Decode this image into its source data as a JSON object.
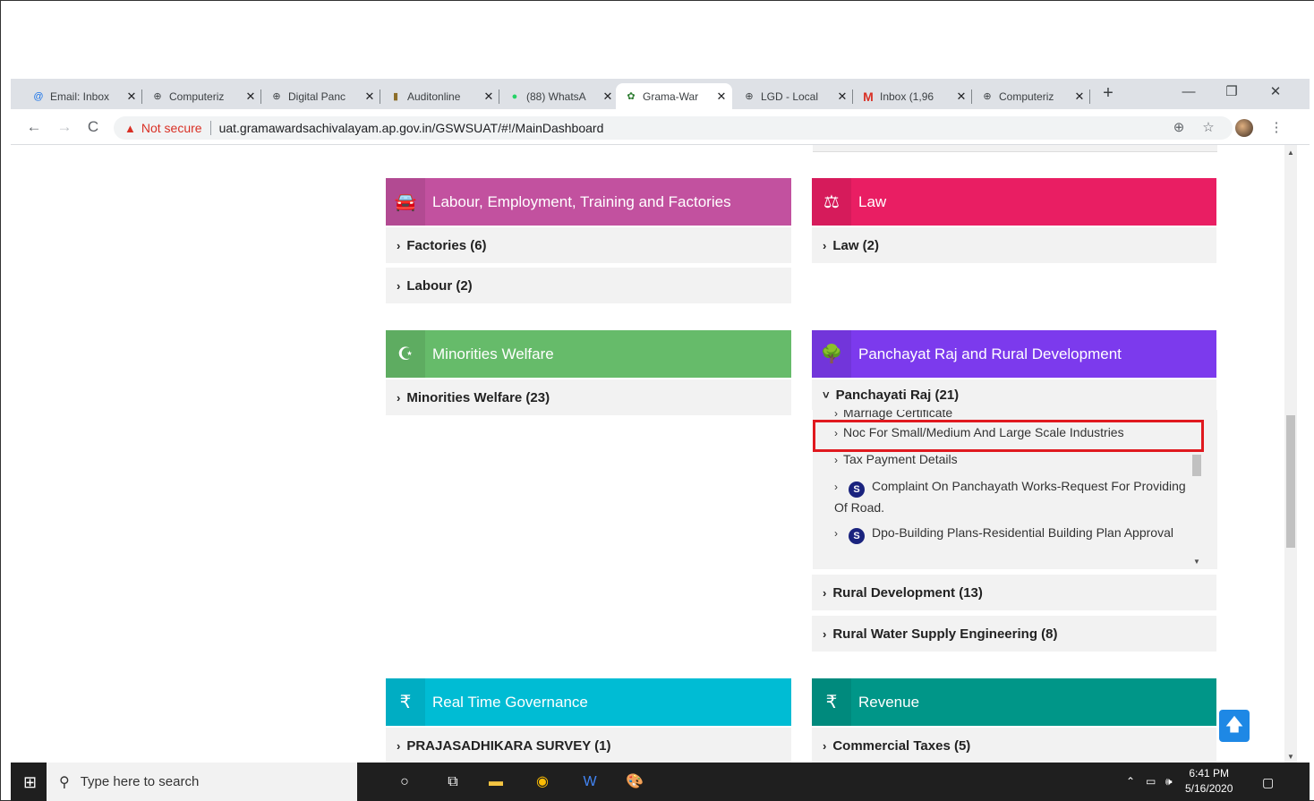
{
  "browser": {
    "tabs": [
      {
        "label": "Email: Inbox",
        "icon": "@",
        "active": false
      },
      {
        "label": "Computeriz",
        "icon": "⊕",
        "active": false
      },
      {
        "label": "Digital Panc",
        "icon": "⊕",
        "active": false
      },
      {
        "label": "Auditonline",
        "icon": "▮",
        "active": false
      },
      {
        "label": "(88) WhatsA",
        "icon": "●",
        "active": false
      },
      {
        "label": "Grama-War",
        "icon": "✿",
        "active": true
      },
      {
        "label": "LGD - Local",
        "icon": "⊕",
        "active": false
      },
      {
        "label": "Inbox (1,96",
        "icon": "M",
        "active": false
      },
      {
        "label": "Computeriz",
        "icon": "⊕",
        "active": false
      }
    ],
    "new_tab": "+",
    "not_secure": "Not secure",
    "url": "uat.gramawardsachivalayam.ap.gov.in/GSWSUAT/#!/MainDashboard"
  },
  "departments": {
    "labour": {
      "title": "Labour, Employment, Training and Factories",
      "color": "#c2519f",
      "items": [
        "Factories (6)",
        "Labour (2)"
      ]
    },
    "law": {
      "title": "Law",
      "color": "#e91e63",
      "items": [
        "Law (2)"
      ]
    },
    "minorities": {
      "title": "Minorities Welfare",
      "color": "#66bb6a",
      "items": [
        "Minorities Welfare (23)"
      ]
    },
    "panchayat": {
      "title": "Panchayat Raj and Rural Development",
      "color": "#7c3aed",
      "expanded_item": "Panchayati Raj (21)",
      "sub_partial": "Marriage Certificate",
      "sub_items": [
        {
          "label": "Noc For Small/Medium And Large Scale Industries",
          "badge": ""
        },
        {
          "label": "Tax Payment Details",
          "badge": ""
        },
        {
          "label": "Complaint On Panchayath Works-Request For Providing Of Road.",
          "badge": "S"
        },
        {
          "label": "Dpo-Building Plans-Residential Building Plan Approval",
          "badge": "S"
        }
      ],
      "items": [
        "Rural Development (13)",
        "Rural Water Supply Engineering (8)"
      ]
    },
    "rtg": {
      "title": "Real Time Governance",
      "color": "#00bcd4",
      "items": [
        "PRAJASADHIKARA SURVEY (1)"
      ]
    },
    "revenue": {
      "title": "Revenue",
      "color": "#009688",
      "items": [
        "Commercial Taxes (5)"
      ]
    }
  },
  "taskbar": {
    "search_placeholder": "Type here to search",
    "time": "6:41 PM",
    "date": "5/16/2020"
  }
}
